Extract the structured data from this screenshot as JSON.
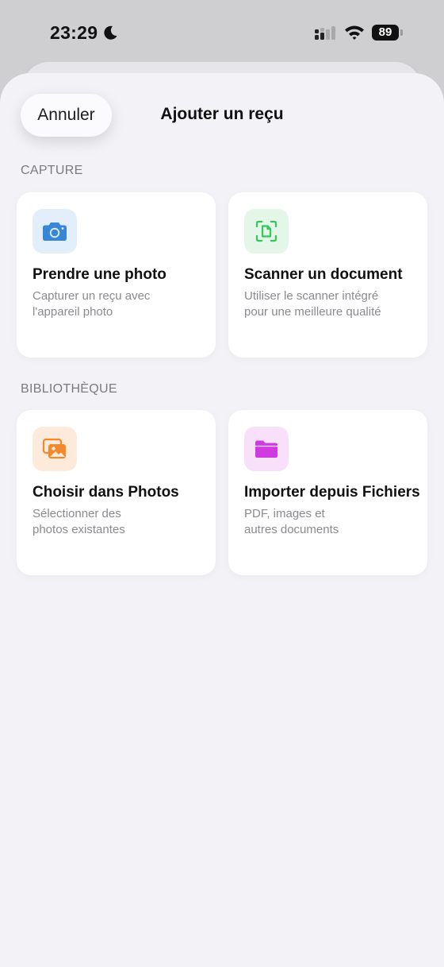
{
  "status_bar": {
    "time": "23:29",
    "battery": "89"
  },
  "sheet": {
    "cancel_label": "Annuler",
    "title": "Ajouter un reçu"
  },
  "sections": {
    "capture": "CAPTURE",
    "library": "BIBLIOTHÈQUE"
  },
  "cards": {
    "photo": {
      "title": "Prendre une photo",
      "desc_line1": "Capturer un reçu avec",
      "desc_line2": "l'appareil photo",
      "icon": "camera-icon",
      "accent": "#3a86d6",
      "bg": "#e2eefa"
    },
    "scan": {
      "title": "Scanner un document",
      "desc_line1": "Utiliser le scanner intégré",
      "desc_line2": "pour une meilleure qualité",
      "icon": "document-scanner-icon",
      "accent": "#34c759",
      "bg": "#e4f6e8"
    },
    "photos": {
      "title": "Choisir dans Photos",
      "desc_line1": "Sélectionner des",
      "desc_line2": "photos existantes",
      "icon": "photo-library-icon",
      "accent": "#f2892a",
      "bg": "#fdeadb"
    },
    "files": {
      "title": "Importer depuis Fichiers",
      "desc_line1": "PDF, images et",
      "desc_line2": "autres documents",
      "icon": "folder-icon",
      "accent": "#d03be0",
      "bg": "#f8e0fa"
    }
  }
}
